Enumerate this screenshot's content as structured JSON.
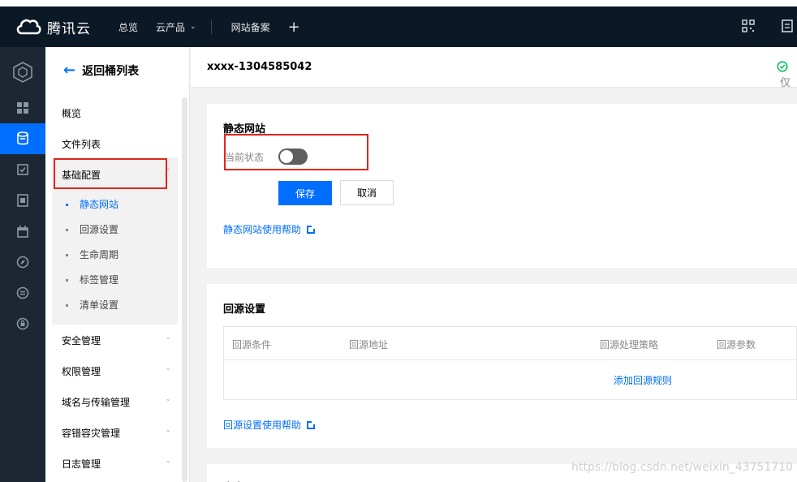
{
  "topbar": {
    "logo_text": "腾讯云",
    "nav_overview": "总览",
    "nav_products": "云产品",
    "nav_beian": "网站备案",
    "nav_plus": "+"
  },
  "rail": {
    "icons": [
      "cube-icon",
      "grid-icon",
      "bucket-icon",
      "checkbox-icon",
      "media-icon",
      "calendar-icon",
      "compass-icon",
      "list-circle-icon",
      "shield-circle-icon"
    ]
  },
  "sidebar": {
    "back_label": "返回桶列表",
    "items": [
      {
        "label": "概览"
      },
      {
        "label": "文件列表"
      },
      {
        "label": "基础配置"
      }
    ],
    "sub_items": [
      {
        "label": "静态网站"
      },
      {
        "label": "回源设置"
      },
      {
        "label": "生命周期"
      },
      {
        "label": "标签管理"
      },
      {
        "label": "清单设置"
      }
    ],
    "lower_items": [
      {
        "label": "安全管理"
      },
      {
        "label": "权限管理"
      },
      {
        "label": "域名与传输管理"
      },
      {
        "label": "容错容灾管理"
      },
      {
        "label": "日志管理"
      }
    ]
  },
  "header": {
    "bucket_name": "xxxx-1304585042",
    "status_partial": "仅"
  },
  "static_site": {
    "title": "静态网站",
    "status_label": "当前状态",
    "enabled": false,
    "save_label": "保存",
    "cancel_label": "取消",
    "help_link": "静态网站使用帮助"
  },
  "origin": {
    "title": "回源设置",
    "columns": [
      "回源条件",
      "回源地址",
      "回源处理策略",
      "回源参数"
    ],
    "add_rule": "添加回源规则",
    "help_link": "回源设置使用帮助"
  },
  "next_card": {
    "title_partial": "自定"
  },
  "watermark": "https://blog.csdn.net/weixin_43751710",
  "colors": {
    "accent": "#006eff",
    "highlight_box": "#e1251b",
    "topbar": "#0b1826",
    "rail": "#1c2733"
  }
}
